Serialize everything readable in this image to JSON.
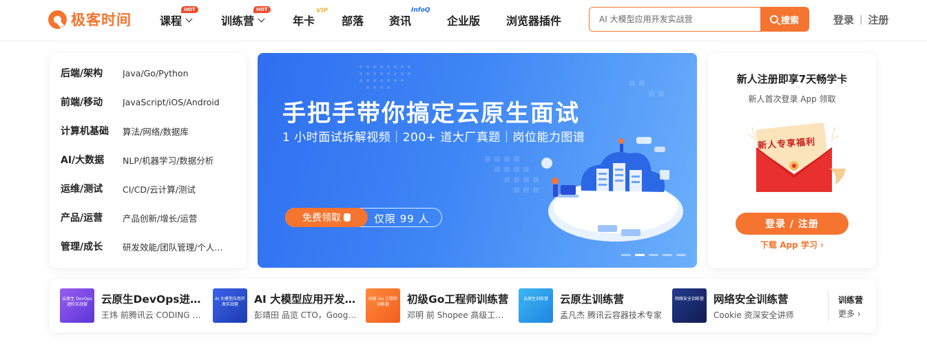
{
  "header": {
    "logo_text": "极客时间",
    "nav": [
      {
        "label": "课程",
        "badge": "HOT"
      },
      {
        "label": "训练营",
        "badge": "HOT"
      },
      {
        "label": "年卡",
        "badge": "VIP"
      },
      {
        "label": "部落"
      },
      {
        "label": "资讯",
        "badge": "InfoQ"
      },
      {
        "label": "企业版"
      },
      {
        "label": "浏览器插件"
      }
    ],
    "search_placeholder": "AI 大模型应用开发实战营",
    "search_button": "搜索",
    "login": "登录",
    "auth_sep": "|",
    "register": "注册"
  },
  "categories": [
    {
      "title": "后端/架构",
      "sub": "Java/Go/Python"
    },
    {
      "title": "前端/移动",
      "sub": "JavaScript/iOS/Android"
    },
    {
      "title": "计算机基础",
      "sub": "算法/网络/数据库"
    },
    {
      "title": "AI/大数据",
      "sub": "NLP/机器学习/数据分析"
    },
    {
      "title": "运维/测试",
      "sub": "CI/CD/云计算/测试"
    },
    {
      "title": "产品/运营",
      "sub": "产品创新/增长/运营"
    },
    {
      "title": "管理/成长",
      "sub": "研发效能/团队管理/个人..."
    }
  ],
  "banner": {
    "title": "手把手带你搞定云原生面试",
    "subtitle": "1 小时面试拆解视频｜200+ 道大厂真题｜岗位能力图谱",
    "cta_left": "免费领取",
    "cta_right": "仅限 99 人",
    "slide_count": 5,
    "active_slide": 2
  },
  "promo_card": {
    "title": "新人注册即享7天畅学卡",
    "subtitle": "新人首次登录 App 领取",
    "envelope_text": "新人专享福利",
    "button": "登录 / 注册",
    "link": "下载 App 学习 ›"
  },
  "camps": [
    {
      "title": "云原生DevOps进阶实战营",
      "desc": "王炜 前腾讯云 CODING 架构师",
      "thumb": "云原生 DevOps 进阶实战营",
      "color": "#7a4fe0"
    },
    {
      "title": "AI 大模型应用开发实战营",
      "desc": "彭靖田 品览 CTO，Google 开发者专家",
      "thumb": "AI 大模型应用开发实战营",
      "color": "#2a4fd8"
    },
    {
      "title": "初级Go工程师训练营",
      "desc": "邓明 前 Shopee 高级工程师",
      "thumb": "初级 Go 工程师训练营",
      "color": "#f5742f"
    },
    {
      "title": "云原生训练营",
      "desc": "孟凡杰 腾讯云容器技术专家",
      "thumb": "云原生训练营",
      "color": "#2aa3f0"
    },
    {
      "title": "网络安全训练营",
      "desc": "Cookie 资深安全讲师",
      "thumb": "网络安全训练营",
      "color": "#1c2c6e"
    }
  ],
  "camps_more": {
    "title": "训练营",
    "link": "更多 ›"
  },
  "colors": {
    "accent": "#f5742f",
    "banner_blue": "#3e86f5"
  }
}
